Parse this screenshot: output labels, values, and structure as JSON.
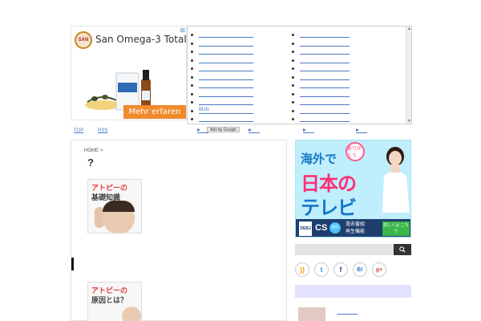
{
  "top_ad": {
    "logo": "SAN",
    "title": "San Omega-3 Total",
    "cta": "Mehr erfaren",
    "close": "⊠"
  },
  "link_box": {
    "col1_bottom_text": "BUN"
  },
  "nav": {
    "items": [
      "TOP",
      "RSS"
    ],
    "ads_by": "Ads by Google"
  },
  "main": {
    "breadcrumb": "HOME >",
    "title": "?",
    "thumb1": {
      "line1": "アトピーの",
      "line2": "基礎知識"
    },
    "thumb2": {
      "line1": "アトピーの",
      "line2": "原因とは？"
    }
  },
  "side_ad": {
    "line1": "海外で",
    "badge": "ありがとう",
    "line2": "日本の",
    "line3": "テレビ",
    "cs": "CS",
    "bs": "BS",
    "info": [
      "過去番組",
      "再生機能"
    ],
    "button": "詳しくは\nこちら",
    "logo": "DEBJ"
  },
  "social": {
    "rss": "))",
    "twitter": "t",
    "facebook": "f",
    "hatena": "B!",
    "google": "g+"
  },
  "colors": {
    "link": "#4a7bc4",
    "orange": "#f08a2c",
    "ad_bg": "#bfeefc"
  }
}
